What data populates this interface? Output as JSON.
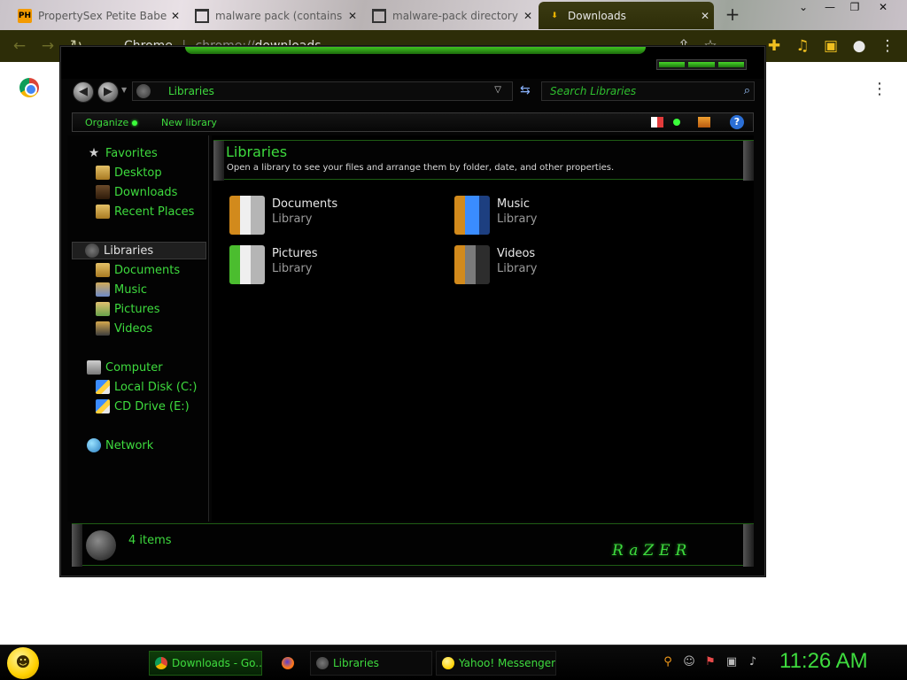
{
  "browser": {
    "tabs": [
      {
        "title": "PropertySex Petite Babe",
        "icon": "ph-favicon",
        "close": "✕"
      },
      {
        "title": "malware pack (contains",
        "icon": "archive-favicon",
        "close": "✕"
      },
      {
        "title": "malware-pack directory",
        "icon": "archive-favicon",
        "close": "✕"
      },
      {
        "title": "Downloads",
        "icon": "download-favicon",
        "close": "✕"
      }
    ],
    "new_tab": "+",
    "window_controls": {
      "dropdown": "⌄",
      "minimize": "—",
      "restore": "❐",
      "close": "✕"
    },
    "address": {
      "site": "Chrome",
      "separator": "|",
      "scheme": "chrome://",
      "path": "downloads"
    },
    "toolbar_icons": {
      "back": "←",
      "forward": "→",
      "reload": "↻",
      "share": "⇪",
      "bookmark": "☆",
      "extensions": "✚",
      "media": "♫",
      "sidebar": "▣",
      "profile": "●",
      "menu": "⋮"
    },
    "page_menu": "⋮"
  },
  "explorer": {
    "address": "Libraries",
    "search_placeholder": "Search Libraries",
    "commands": {
      "organize": "Organize",
      "new_library": "New library"
    },
    "help": "?",
    "nav": {
      "favorites": {
        "label": "Favorites",
        "items": [
          "Desktop",
          "Downloads",
          "Recent Places"
        ]
      },
      "libraries": {
        "label": "Libraries",
        "items": [
          "Documents",
          "Music",
          "Pictures",
          "Videos"
        ]
      },
      "computer": {
        "label": "Computer",
        "items": [
          "Local Disk (C:)",
          "CD Drive (E:)"
        ]
      },
      "network": {
        "label": "Network"
      }
    },
    "header": {
      "title": "Libraries",
      "description": "Open a library to see your files and arrange them by folder, date, and other properties."
    },
    "libraries": [
      {
        "name": "Documents",
        "type": "Library"
      },
      {
        "name": "Music",
        "type": "Library"
      },
      {
        "name": "Pictures",
        "type": "Library"
      },
      {
        "name": "Videos",
        "type": "Library"
      }
    ],
    "status": {
      "count": "4 items",
      "brand": "RaZER"
    }
  },
  "taskbar": {
    "tasks": [
      {
        "label": "Downloads - Go..."
      },
      {
        "label": ""
      },
      {
        "label": "Libraries"
      },
      {
        "label": "Yahoo! Messenger"
      }
    ],
    "clock": "11:26 AM"
  },
  "colors": {
    "accent_green": "#3edb3e",
    "chrome_dark": "#2d2d08",
    "explorer_bg": "#050505"
  }
}
